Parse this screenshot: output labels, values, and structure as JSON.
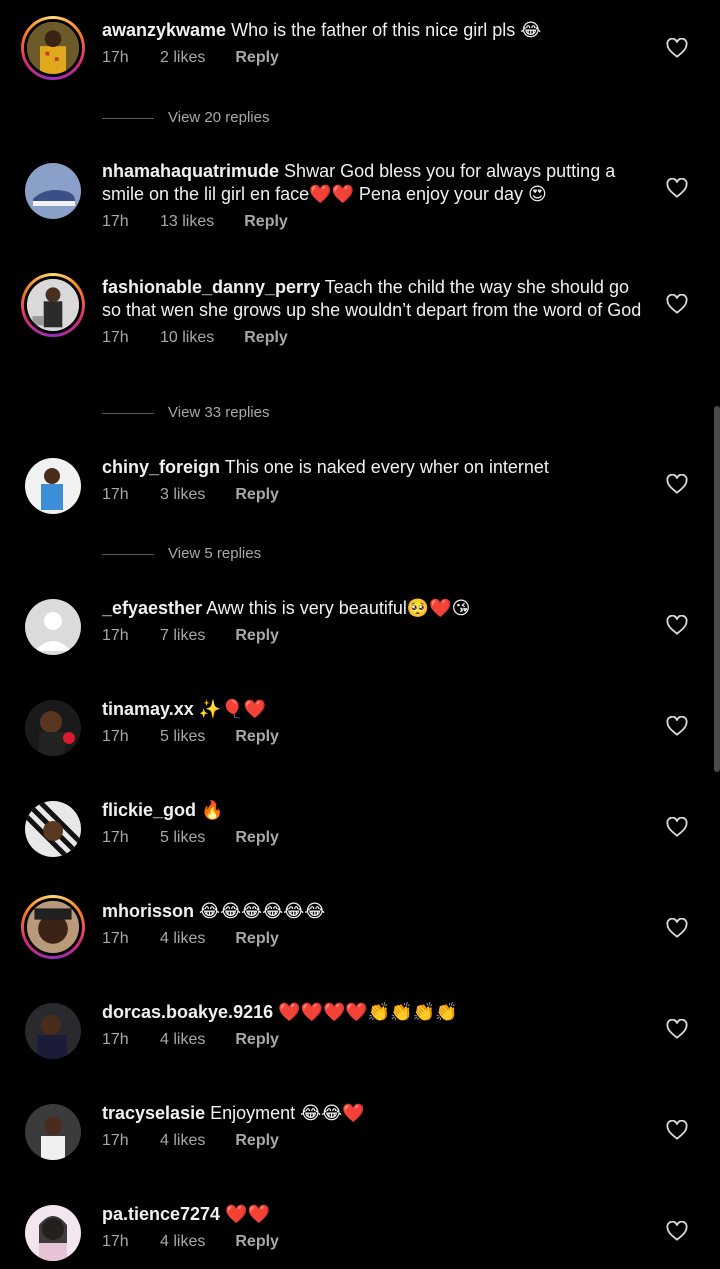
{
  "comments": [
    {
      "username": "awanzykwame",
      "text": "Who is the father of this nice girl pls 😂",
      "time": "17h",
      "likes": "2 likes",
      "reply": "Reply"
    },
    {
      "username": "nhamahaquatrimude",
      "text": "Shwar God bless you for always putting a smile on the lil girl en face❤️❤️ Pena enjoy your day 😍",
      "time": "17h",
      "likes": "13 likes",
      "reply": "Reply"
    },
    {
      "username": "fashionable_danny_perry",
      "text": "Teach the child the way she should go so that wen she grows up she wouldn’t depart from the word of God",
      "time": "17h",
      "likes": "10 likes",
      "reply": "Reply"
    },
    {
      "username": "chiny_foreign",
      "text": "This one is naked every wher on internet",
      "time": "17h",
      "likes": "3 likes",
      "reply": "Reply"
    },
    {
      "username": "_efyaesther",
      "text": "Aww this is very beautiful🥺❤️😘",
      "time": "17h",
      "likes": "7 likes",
      "reply": "Reply"
    },
    {
      "username": "tinamay.xx",
      "text": "✨🎈❤️",
      "time": "17h",
      "likes": "5 likes",
      "reply": "Reply"
    },
    {
      "username": "flickie_god",
      "text": "🔥",
      "time": "17h",
      "likes": "5 likes",
      "reply": "Reply"
    },
    {
      "username": "mhorisson",
      "text": "😂😂😂😂😂😂",
      "time": "17h",
      "likes": "4 likes",
      "reply": "Reply"
    },
    {
      "username": "dorcas.boakye.9216",
      "text": "❤️❤️❤️❤️👏👏👏👏",
      "time": "17h",
      "likes": "4 likes",
      "reply": "Reply"
    },
    {
      "username": "tracyselasie",
      "text": "Enjoyment 😂😂❤️",
      "time": "17h",
      "likes": "4 likes",
      "reply": "Reply"
    },
    {
      "username": "pa.tience7274",
      "text": "❤️❤️",
      "time": "17h",
      "likes": "4 likes",
      "reply": "Reply"
    }
  ],
  "view_replies": [
    {
      "label": "View 20 replies"
    },
    {
      "label": "View 33 replies"
    },
    {
      "label": "View 5 replies"
    }
  ],
  "colors": {
    "background": "#000000",
    "text": "#f0f0f0",
    "secondary_text": "#a8a8a8",
    "story_ring": "#d62976"
  },
  "icons": {
    "like": "heart-outline-icon"
  }
}
